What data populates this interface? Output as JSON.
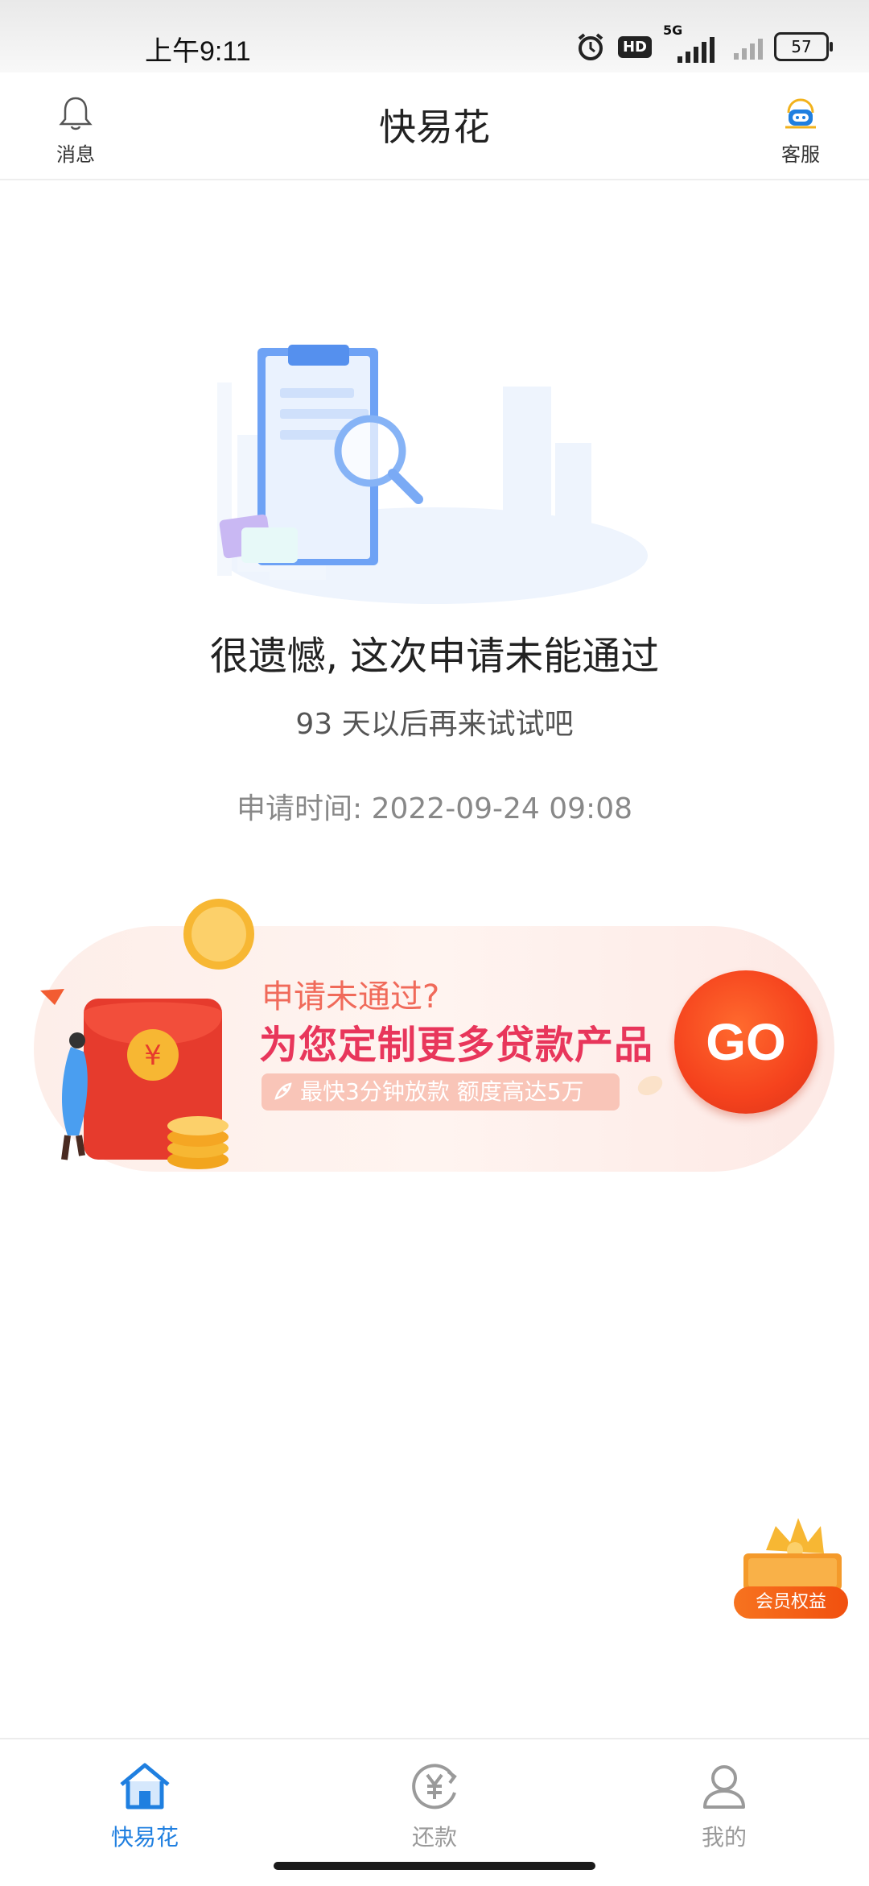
{
  "status_bar": {
    "time": "上午9:11",
    "network": "5G",
    "hd": "HD",
    "battery": "57"
  },
  "header": {
    "title": "快易花",
    "left_label": "消息",
    "right_label": "客服"
  },
  "result": {
    "title": "很遗憾, 这次申请未能通过",
    "subtitle": "93 天以后再来试试吧",
    "time_label": "申请时间:",
    "time_value": "2022-09-24 09:08"
  },
  "banner": {
    "question": "申请未通过?",
    "headline": "为您定制更多贷款产品",
    "perks": "最快3分钟放款  额度高达5万",
    "go_label": "GO"
  },
  "member": {
    "label": "会员权益"
  },
  "bottom_nav": {
    "items": [
      {
        "label": "快易花",
        "active": true
      },
      {
        "label": "还款",
        "active": false
      },
      {
        "label": "我的",
        "active": false
      }
    ]
  },
  "colors": {
    "accent": "#1f7fe0",
    "inactive": "#9a9a9a",
    "banner_red": "#e8365b",
    "go_orange": "#f5421d"
  }
}
